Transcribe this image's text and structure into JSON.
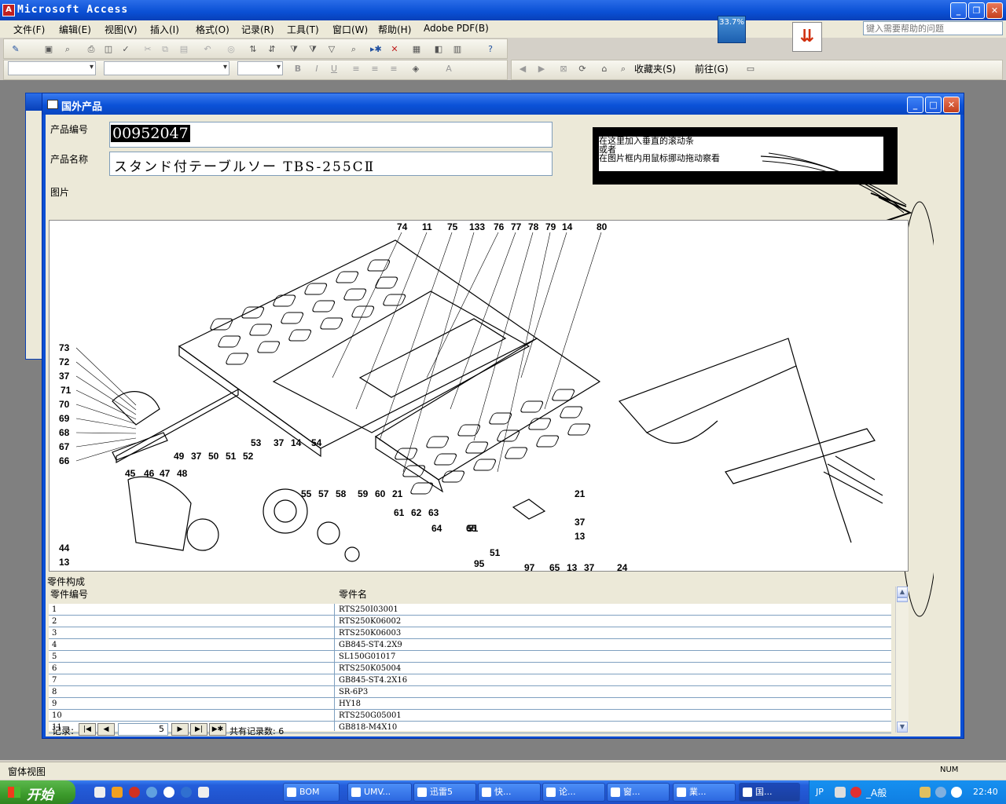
{
  "app": {
    "title": "Microsoft Access"
  },
  "menu": [
    "文件(F)",
    "编辑(E)",
    "视图(V)",
    "插入(I)",
    "格式(O)",
    "记录(R)",
    "工具(T)",
    "窗口(W)",
    "帮助(H)",
    "Adobe PDF(B)"
  ],
  "help": {
    "placeholder": "键入需要帮助的问题"
  },
  "indicator": {
    "percent": "33.7%"
  },
  "toolbar2": {
    "favorites": "收藏夹(S)",
    "goto": "前往(G)"
  },
  "form": {
    "title": "国外产品",
    "product_code_label": "产品编号",
    "product_code": "00952047",
    "product_name_label": "产品名称",
    "product_name": "スタンド付テーブルソー TBS-255CⅡ",
    "picture_label": "图片",
    "note": {
      "line1": "在这里加入垂直的滚动条",
      "line2": "或者",
      "line3": "在图片框内用鼠标挪动拖动察看"
    },
    "parts_label": "零件构成",
    "col_part_no": "零件编号",
    "col_part_name": "零件名"
  },
  "parts": [
    [
      "1",
      "RTS250I03001"
    ],
    [
      "2",
      "RTS250K06002"
    ],
    [
      "3",
      "RTS250K06003"
    ],
    [
      "4",
      "GB845-ST4.2X9"
    ],
    [
      "5",
      "SL150G01017"
    ],
    [
      "6",
      "RTS250K05004"
    ],
    [
      "7",
      "GB845-ST4.2X16"
    ],
    [
      "8",
      "SR-6P3"
    ],
    [
      "9",
      "HY18"
    ],
    [
      "10",
      "RTS250G05001"
    ],
    [
      "11",
      "GB818-M4X10"
    ]
  ],
  "diagram_labels": [
    "74",
    "11",
    "75",
    "133",
    "76",
    "77",
    "78",
    "79",
    "14",
    "80",
    "73",
    "72",
    "37",
    "71",
    "70",
    "69",
    "68",
    "67",
    "66",
    "53",
    "37",
    "14",
    "54",
    "49",
    "37",
    "50",
    "51",
    "52",
    "45",
    "46",
    "47",
    "48",
    "55",
    "57",
    "58",
    "59",
    "60",
    "21",
    "61",
    "62",
    "63",
    "64",
    "65",
    "51",
    "21",
    "37",
    "13",
    "44",
    "13",
    "95",
    "51",
    "97",
    "65",
    "13",
    "37",
    "24"
  ],
  "record_nav": {
    "label": "记录:",
    "current": "5",
    "total_text": "共有记录数: 6"
  },
  "statusbar": {
    "text": "窗体视图",
    "num": "NUM"
  },
  "taskbar": {
    "start": "开始",
    "tasks": [
      "BOM",
      "UMV...",
      "迅雷5",
      "快...",
      "论...",
      "窗...",
      "業...",
      "国..."
    ],
    "lang": "JP",
    "tray_text": "_A般",
    "clock": "22:40"
  }
}
